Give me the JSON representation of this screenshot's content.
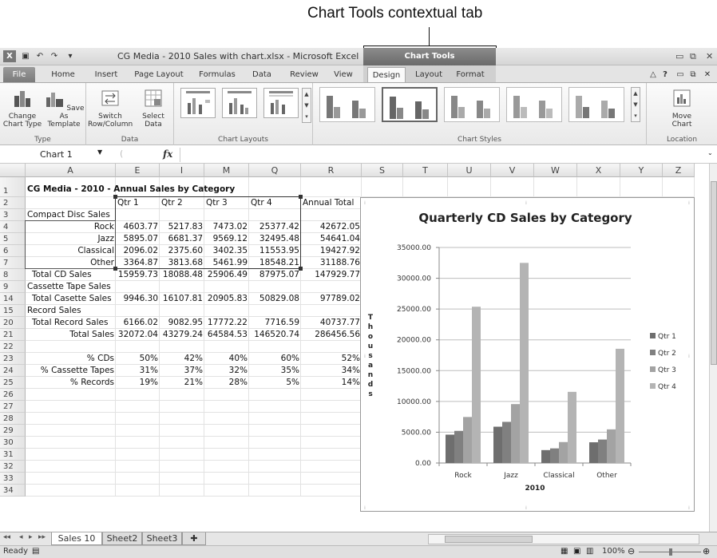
{
  "callout": {
    "text": "Chart Tools contextual tab"
  },
  "titlebar": {
    "title": "CG Media - 2010 Sales with chart.xlsx - Microsoft Excel",
    "context_tab": "Chart Tools",
    "quick_access": [
      "excel-logo-icon",
      "save-icon",
      "undo-icon",
      "redo-icon",
      "customize-qat-icon"
    ]
  },
  "tabs": {
    "file": "File",
    "items": [
      "Home",
      "Insert",
      "Page Layout",
      "Formulas",
      "Data",
      "Review",
      "View",
      "Design",
      "Layout",
      "Format"
    ],
    "active": "Design"
  },
  "ribbon": {
    "groups": {
      "type": {
        "label": "Type",
        "buttons": [
          "Change Chart Type",
          "Save As Template"
        ]
      },
      "data": {
        "label": "Data",
        "buttons": [
          "Switch Row/Column",
          "Select Data"
        ]
      },
      "layouts": {
        "label": "Chart Layouts"
      },
      "styles": {
        "label": "Chart Styles"
      },
      "location": {
        "label": "Location",
        "buttons": [
          "Move Chart"
        ]
      }
    }
  },
  "formula_bar": {
    "name_box": "Chart 1",
    "fx": "fx",
    "formula": ""
  },
  "grid": {
    "columns": [
      "A",
      "E",
      "I",
      "M",
      "Q",
      "R",
      "S",
      "T",
      "U",
      "V",
      "W",
      "X",
      "Y",
      "Z"
    ],
    "row_numbers": [
      "1",
      "2",
      "3",
      "4",
      "5",
      "6",
      "7",
      "8",
      "9",
      "14",
      "15",
      "20",
      "21",
      "22",
      "23",
      "24",
      "25",
      "26",
      "27",
      "28",
      "29",
      "30",
      "31",
      "32",
      "33",
      "34"
    ],
    "title": "CG Media - 2010 - Annual Sales by Category",
    "headers": [
      "Qtr 1",
      "Qtr 2",
      "Qtr 3",
      "Qtr 4",
      "Annual Total"
    ],
    "rows": [
      {
        "label": "Compact Disc Sales",
        "align": "left",
        "values": []
      },
      {
        "label": "Rock",
        "align": "right",
        "values": [
          "4603.77",
          "5217.83",
          "7473.02",
          "25377.42",
          "42672.05"
        ]
      },
      {
        "label": "Jazz",
        "align": "right",
        "values": [
          "5895.07",
          "6681.37",
          "9569.12",
          "32495.48",
          "54641.04"
        ]
      },
      {
        "label": "Classical",
        "align": "right",
        "values": [
          "2096.02",
          "2375.60",
          "3402.35",
          "11553.95",
          "19427.92"
        ]
      },
      {
        "label": "Other",
        "align": "right",
        "values": [
          "3364.87",
          "3813.68",
          "5461.99",
          "18548.21",
          "31188.76"
        ]
      },
      {
        "label": "Total CD Sales",
        "align": "indent",
        "values": [
          "15959.73",
          "18088.48",
          "25906.49",
          "87975.07",
          "147929.77"
        ]
      },
      {
        "label": "Cassette Tape Sales",
        "align": "left",
        "values": []
      },
      {
        "label": "Total Casette Sales",
        "align": "indent",
        "values": [
          "9946.30",
          "16107.81",
          "20905.83",
          "50829.08",
          "97789.02"
        ]
      },
      {
        "label": "Record Sales",
        "align": "left",
        "values": []
      },
      {
        "label": "Total Record Sales",
        "align": "indent",
        "values": [
          "6166.02",
          "9082.95",
          "17772.22",
          "7716.59",
          "40737.77"
        ]
      },
      {
        "label": "Total Sales",
        "align": "right",
        "values": [
          "32072.04",
          "43279.24",
          "64584.53",
          "146520.74",
          "286456.56"
        ]
      },
      {
        "label": "",
        "align": "left",
        "values": []
      },
      {
        "label": "% CDs",
        "align": "right",
        "values": [
          "50%",
          "42%",
          "40%",
          "60%",
          "52%"
        ]
      },
      {
        "label": "% Cassette Tapes",
        "align": "right",
        "values": [
          "31%",
          "37%",
          "32%",
          "35%",
          "34%"
        ]
      },
      {
        "label": "% Records",
        "align": "right",
        "values": [
          "19%",
          "21%",
          "28%",
          "5%",
          "14%"
        ]
      }
    ]
  },
  "chart_data": {
    "type": "bar",
    "title": "Quarterly CD Sales by Category",
    "xlabel": "2010",
    "ylabel": "Thousands",
    "categories": [
      "Rock",
      "Jazz",
      "Classical",
      "Other"
    ],
    "series": [
      {
        "name": "Qtr 1",
        "values": [
          4603.77,
          5895.07,
          2096.02,
          3364.87
        ],
        "color": "#6e6e6e"
      },
      {
        "name": "Qtr 2",
        "values": [
          5217.83,
          6681.37,
          2375.6,
          3813.68
        ],
        "color": "#808080"
      },
      {
        "name": "Qtr 3",
        "values": [
          7473.02,
          9569.12,
          3402.35,
          5461.99
        ],
        "color": "#a3a3a3"
      },
      {
        "name": "Qtr 4",
        "values": [
          25377.42,
          32495.48,
          11553.95,
          18548.21
        ],
        "color": "#b4b4b4"
      }
    ],
    "yticks": [
      "0.00",
      "5000.00",
      "10000.00",
      "15000.00",
      "20000.00",
      "25000.00",
      "30000.00",
      "35000.00"
    ],
    "ylim": [
      0,
      35000
    ],
    "grid": true,
    "legend": "right"
  },
  "sheets": {
    "tabs": [
      "Sales 10",
      "Sheet2",
      "Sheet3"
    ],
    "active": "Sales 10"
  },
  "status": {
    "ready": "Ready",
    "zoom": "100%"
  }
}
